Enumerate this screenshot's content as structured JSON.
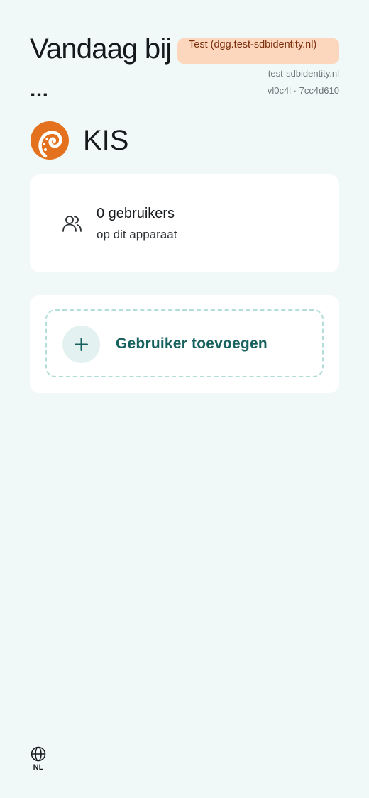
{
  "header": {
    "title_line1": "Vandaag bij",
    "title_line2": "...",
    "environment_badge": "Test (dgg.test-sdbidentity.nl)",
    "environment_host": "test-sdbidentity.nl",
    "version": "vl0c4l · 7cc4d610"
  },
  "brand": {
    "name": "KIS",
    "logo_icon": "octopus-tentacle-logo-icon",
    "logo_color": "#e3711d"
  },
  "users_card": {
    "icon": "users-icon",
    "count_text": "0 gebruikers",
    "subtitle": "op dit apparaat"
  },
  "add_user": {
    "icon": "plus-icon",
    "label": "Gebruiker toevoegen",
    "accent_color": "#17615f"
  },
  "language": {
    "icon": "globe-icon",
    "label": "NL"
  },
  "colors": {
    "background": "#f1f9f8",
    "card": "#ffffff",
    "badge_bg": "#fcd7bd",
    "badge_text": "#7a2e0c"
  }
}
